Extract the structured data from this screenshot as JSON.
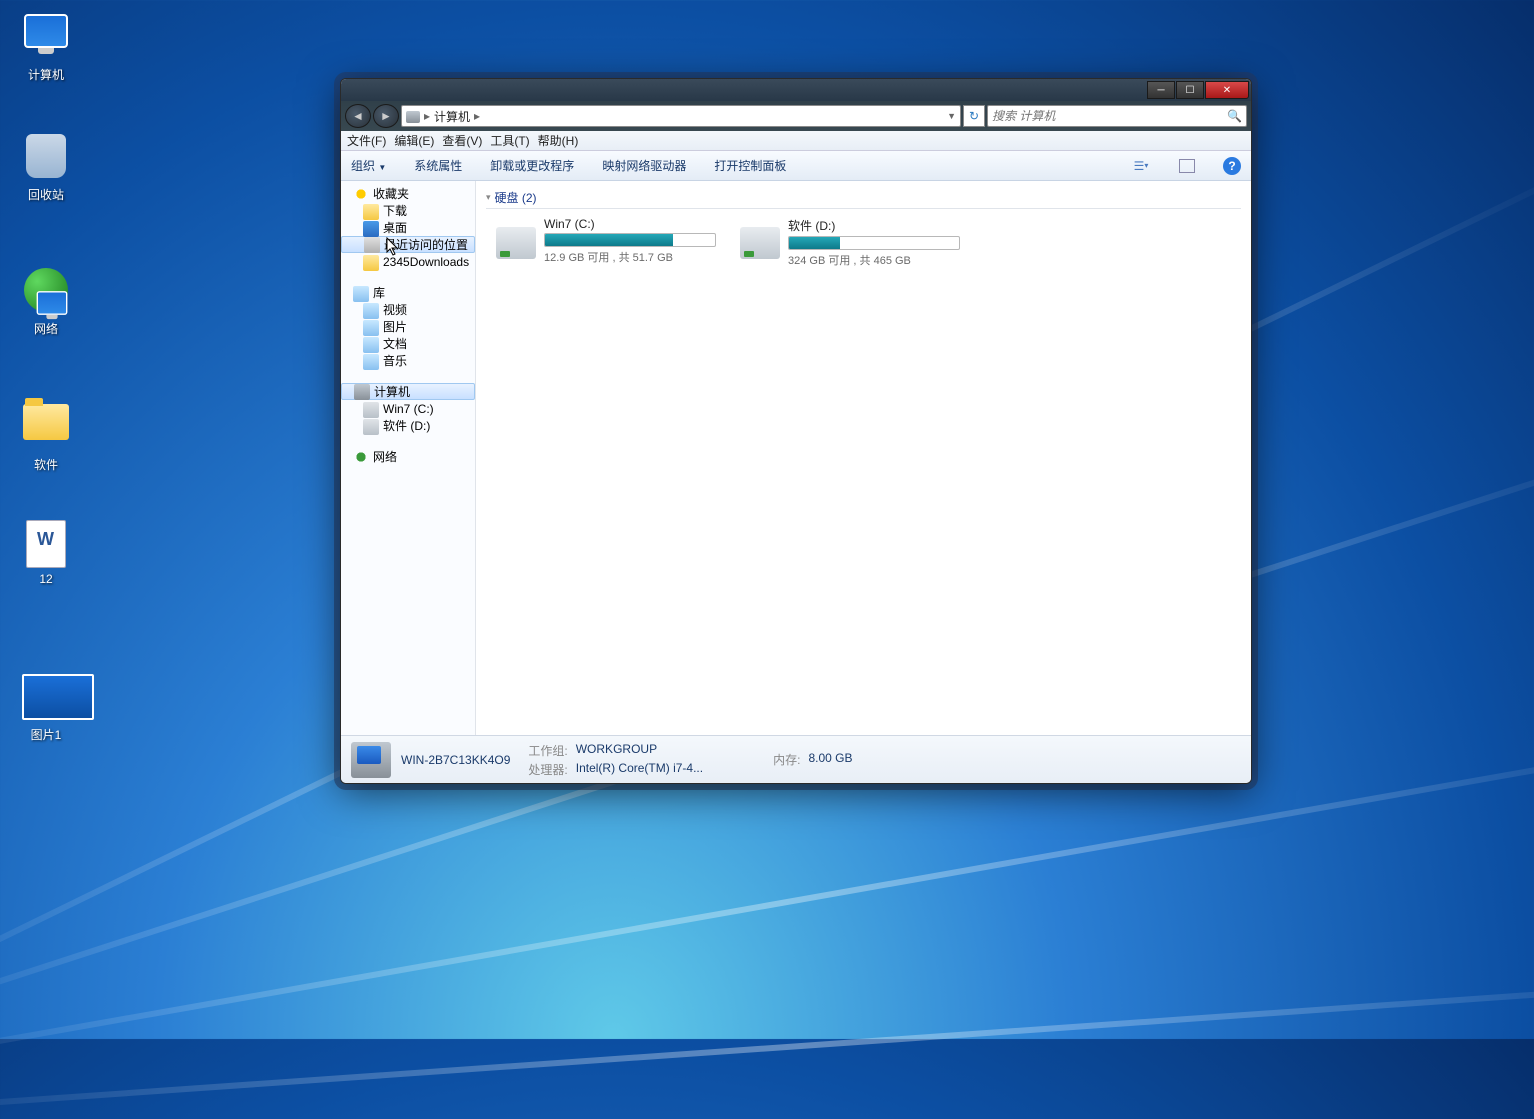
{
  "desktop": {
    "computer": "计算机",
    "recycle": "回收站",
    "network": "网络",
    "software": "软件",
    "doc12": "12",
    "pic1": "图片1"
  },
  "nav": {
    "crumb": "计算机",
    "search_placeholder": "搜索 计算机"
  },
  "menu": {
    "file": "文件(F)",
    "edit": "编辑(E)",
    "view": "查看(V)",
    "tools": "工具(T)",
    "help": "帮助(H)"
  },
  "toolbar": {
    "organize": "组织",
    "sysprops": "系统属性",
    "uninstall": "卸载或更改程序",
    "mapdrive": "映射网络驱动器",
    "controlpanel": "打开控制面板"
  },
  "sidebar": {
    "favorites": "收藏夹",
    "downloads": "下载",
    "desktop": "桌面",
    "recent": "最近访问的位置",
    "dl2345": "2345Downloads",
    "libraries": "库",
    "videos": "视频",
    "pictures": "图片",
    "documents": "文档",
    "music": "音乐",
    "computer": "计算机",
    "drive_c": "Win7 (C:)",
    "drive_d": "软件 (D:)",
    "network": "网络"
  },
  "content": {
    "section_disks": "硬盘 (2)",
    "drives": {
      "c": {
        "name": "Win7 (C:)",
        "stat": "12.9 GB 可用 , 共 51.7 GB",
        "fill_pct": 75
      },
      "d": {
        "name": "软件 (D:)",
        "stat": "324 GB 可用 , 共 465 GB",
        "fill_pct": 30
      }
    }
  },
  "status": {
    "name": "WIN-2B7C13KK4O9",
    "workgroup_lbl": "工作组:",
    "workgroup": "WORKGROUP",
    "mem_lbl": "内存:",
    "mem": "8.00 GB",
    "cpu_lbl": "处理器:",
    "cpu": "Intel(R) Core(TM) i7-4..."
  }
}
